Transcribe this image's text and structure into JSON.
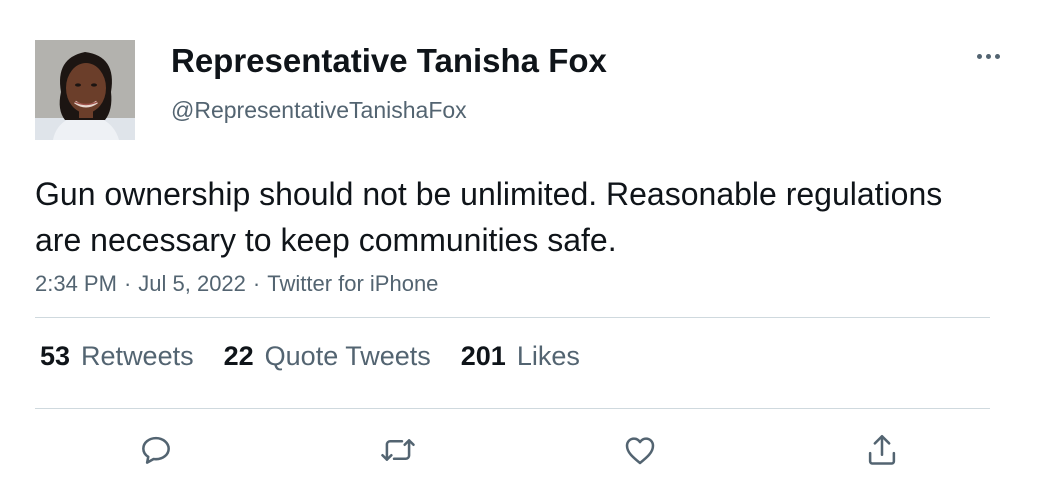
{
  "tweet": {
    "author": {
      "name": "Representative Tanisha Fox",
      "handle": "@RepresentativeTanishaFox"
    },
    "text": "Gun ownership should not be unlimited. Reasonable regulations are necessary to keep communities safe.",
    "meta": {
      "time": "2:34 PM",
      "date": "Jul 5, 2022",
      "source": "Twitter for iPhone",
      "separator": "·"
    },
    "stats": {
      "retweets": {
        "count": "53",
        "label": "Retweets"
      },
      "quote_tweets": {
        "count": "22",
        "label": "Quote Tweets"
      },
      "likes": {
        "count": "201",
        "label": "Likes"
      }
    },
    "actions": [
      "reply-icon",
      "retweet-icon",
      "like-icon",
      "share-icon"
    ]
  },
  "colors": {
    "text_primary": "#0f1419",
    "text_secondary": "#536471",
    "divider": "#cfd9de"
  }
}
